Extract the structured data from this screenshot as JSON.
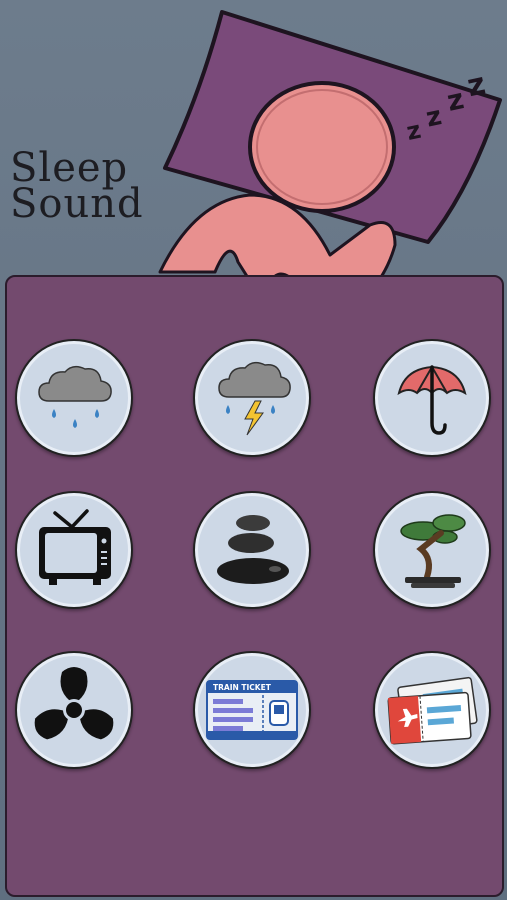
{
  "app": {
    "title_line1": "Sleep",
    "title_line2": "Sound"
  },
  "sounds": [
    {
      "name": "rain",
      "icon": "rain-cloud-icon"
    },
    {
      "name": "thunderstorm",
      "icon": "thunder-cloud-icon"
    },
    {
      "name": "umbrella",
      "icon": "umbrella-icon"
    },
    {
      "name": "tv-static",
      "icon": "tv-icon"
    },
    {
      "name": "stones",
      "icon": "zen-stones-icon"
    },
    {
      "name": "bonsai",
      "icon": "bonsai-icon"
    },
    {
      "name": "fan",
      "icon": "fan-icon"
    },
    {
      "name": "train",
      "icon": "train-ticket-icon",
      "label": "TRAIN TICKET"
    },
    {
      "name": "airplane",
      "icon": "plane-ticket-icon"
    }
  ],
  "colors": {
    "background": "#6d7c8c",
    "panel": "#734a6e",
    "pillow": "#7a4a7a",
    "skin": "#e8908f",
    "button": "#cdd8e6"
  }
}
